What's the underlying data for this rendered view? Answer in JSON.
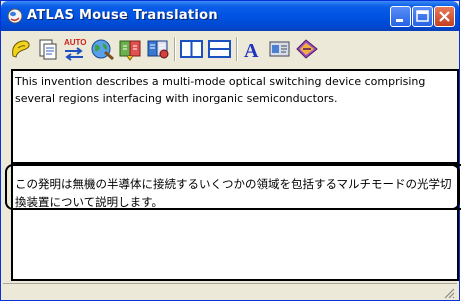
{
  "window": {
    "title": "ATLAS Mouse Translation"
  },
  "toolbar": {
    "buttons": [
      "lookup-icon",
      "document-icon",
      "auto-swap-icon",
      "globe-icon",
      "dictionary-icon",
      "user-dictionary-icon",
      "split-vertical-icon",
      "split-horizontal-icon",
      "font-icon",
      "options-icon",
      "help-icon"
    ],
    "auto_label": "AUTO"
  },
  "source": {
    "text": "This invention describes a multi-mode optical switching device comprising several regions interfacing with inorganic semiconductors."
  },
  "translation": {
    "text": "この発明は無機の半導体に接続するいくつかの領域を包括するマルチモードの光学切換装置について説明します。"
  },
  "colors": {
    "titlebar": "#0054e3",
    "window_bg": "#ece9d8",
    "close_button": "#c4401f"
  }
}
